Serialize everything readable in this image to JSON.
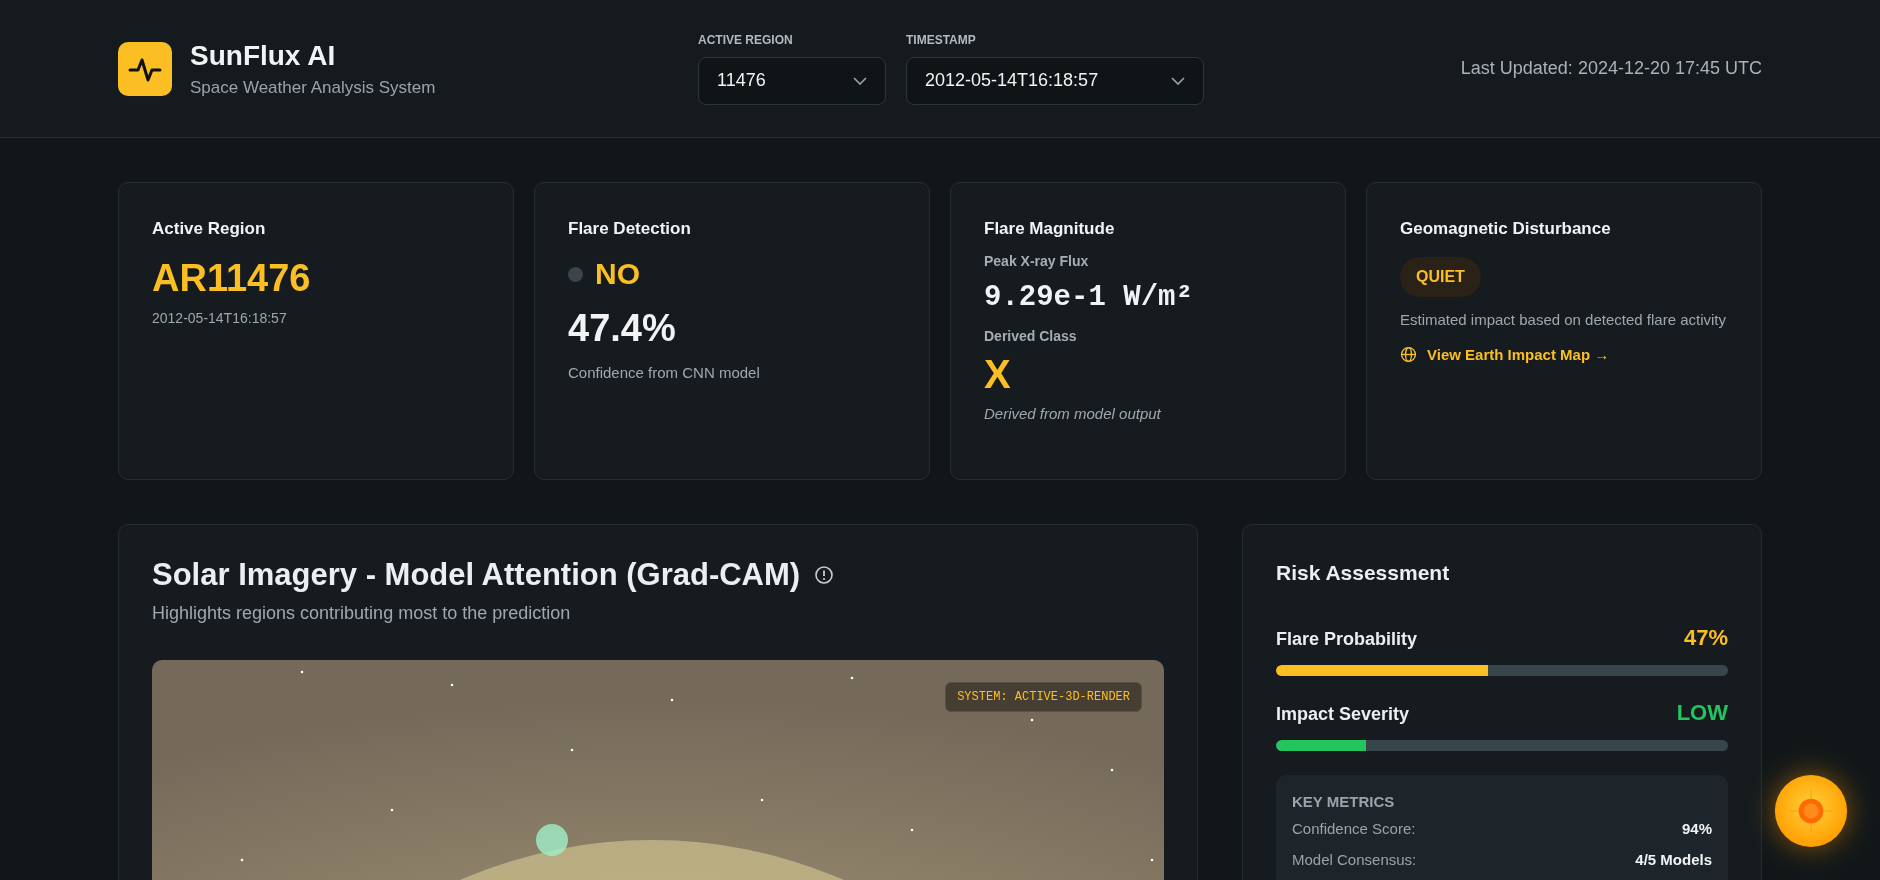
{
  "header": {
    "title": "SunFlux AI",
    "subtitle": "Space Weather Analysis System",
    "selects": [
      {
        "label": "ACTIVE REGION",
        "value": "11476"
      },
      {
        "label": "TIMESTAMP",
        "value": "2012-05-14T16:18:57"
      }
    ],
    "last_updated": "Last Updated: 2024-12-20 17:45 UTC"
  },
  "cards": [
    {
      "kind": "region",
      "title": "Active Region",
      "value": "AR11476",
      "sub": "2012-05-14T16:18:57"
    },
    {
      "kind": "detection",
      "title": "Flare Detection",
      "detected": false,
      "answer": "NO",
      "percent": "47.4%",
      "caption": "Confidence from CNN model"
    },
    {
      "kind": "magnitude",
      "title": "Flare Magnitude",
      "flux_label": "Peak X-ray Flux",
      "flux": "9.29e-1 W/m²",
      "class_label": "Derived Class",
      "class": "X",
      "note": "Derived from model output"
    },
    {
      "kind": "geomagnetic",
      "title": "Geomagnetic Disturbance",
      "badge": "QUIET",
      "description": "Estimated impact based on detected flare activity",
      "link": "View Earth Impact Map →"
    }
  ],
  "imagery": {
    "title": "Solar Imagery - Model Attention (Grad-CAM)",
    "subtitle": "Highlights regions contributing most to the prediction",
    "badge": "SYSTEM: ACTIVE-3D-RENDER"
  },
  "risk": {
    "title": "Risk Assessment",
    "bars": [
      {
        "label": "Flare Probability",
        "reading": "47%",
        "level": 0.47,
        "color": "#fbbf24"
      },
      {
        "label": "Impact Severity",
        "reading": "LOW",
        "level": 0.2,
        "color": "#22c55e"
      }
    ],
    "metrics_title": "KEY METRICS",
    "metrics": [
      {
        "label": "Confidence Score:",
        "value": "94%"
      },
      {
        "label": "Model Consensus:",
        "value": "4/5 Models"
      }
    ]
  }
}
